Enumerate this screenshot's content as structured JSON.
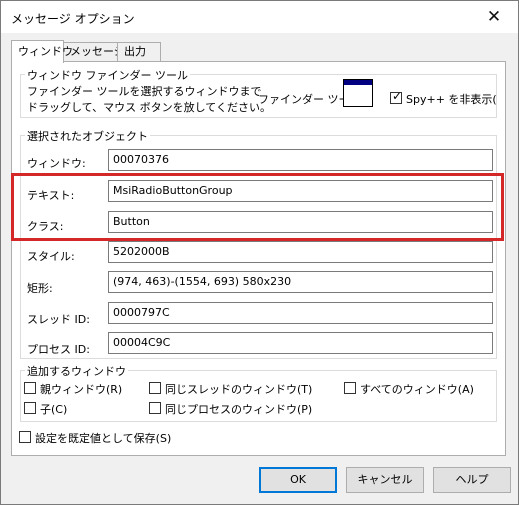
{
  "window": {
    "title": "メッセージ オプション",
    "close_glyph": "✕"
  },
  "tabs": [
    {
      "label": "ウィンドウ"
    },
    {
      "label": "メッセージ"
    },
    {
      "label": "出力"
    }
  ],
  "finder": {
    "legend": "ウィンドウ ファインダー ツール",
    "line1": "ファインダー ツールを選択するウィンドウまで",
    "line2": "ドラッグして、マウス ボタンを放してください。",
    "tool_label": "ファインダー ツール:",
    "hide_spy_label": "Spy++ を非表示(",
    "hide_spy_checked": true
  },
  "selected": {
    "legend": "選択されたオブジェクト",
    "fields": [
      {
        "label": "ウィンドウ:",
        "value": "00070376"
      },
      {
        "label": "テキスト:",
        "value": "MsiRadioButtonGroup"
      },
      {
        "label": "クラス:",
        "value": "Button"
      },
      {
        "label": "スタイル:",
        "value": "5202000B"
      },
      {
        "label": "矩形:",
        "value": "(974, 463)-(1554, 693) 580x230"
      },
      {
        "label": "スレッド ID:",
        "value": "0000797C"
      },
      {
        "label": "プロセス ID:",
        "value": "00004C9C"
      }
    ]
  },
  "additional": {
    "legend": "追加するウィンドウ",
    "options": [
      {
        "label": "親ウィンドウ(R)",
        "checked": false
      },
      {
        "label": "同じスレッドのウィンドウ(T)",
        "checked": false
      },
      {
        "label": "すべてのウィンドウ(A)",
        "checked": false
      },
      {
        "label": "子(C)",
        "checked": false
      },
      {
        "label": "同じプロセスのウィンドウ(P)",
        "checked": false
      }
    ]
  },
  "save_default": {
    "label": "設定を既定値として保存(S)",
    "checked": false
  },
  "buttons": {
    "ok": "OK",
    "cancel": "キャンセル",
    "help": "ヘルプ"
  },
  "colors": {
    "highlight": "#d42727",
    "focus": "#0078d7"
  }
}
